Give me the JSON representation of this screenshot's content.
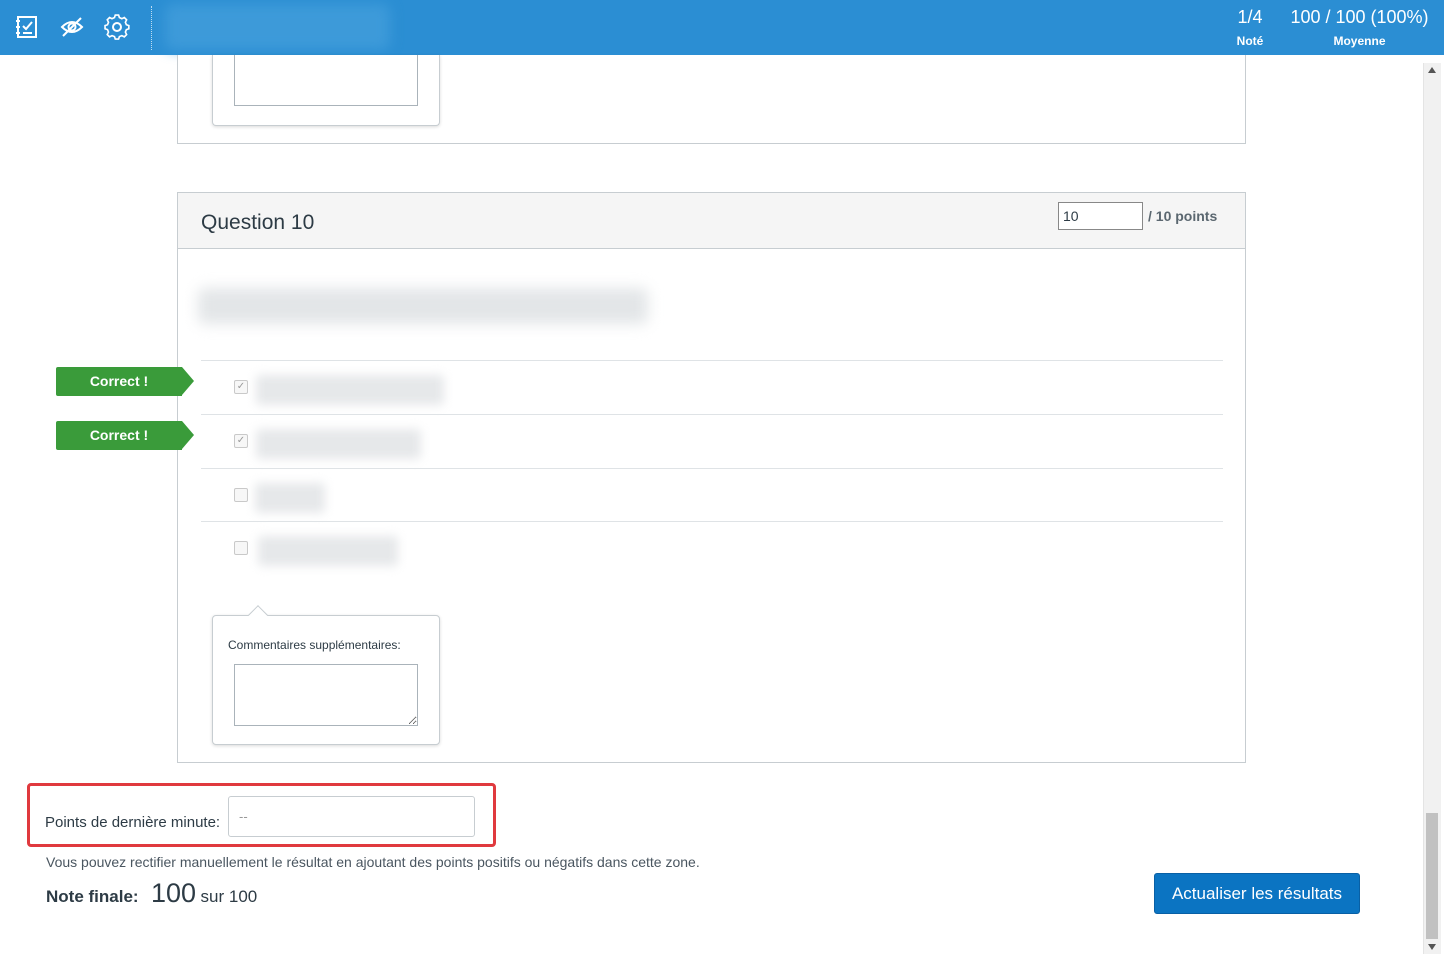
{
  "topbar": {
    "graded_count": "1/4",
    "graded_label": "Noté",
    "average_value": "100 / 100 (100%)",
    "average_label": "Moyenne",
    "icons": [
      "speedgrader-icon",
      "eye-slash-icon",
      "gear-icon"
    ]
  },
  "question": {
    "title": "Question 10",
    "points_value": "10",
    "points_label": "/ 10 points",
    "answers": [
      {
        "checked": true,
        "correct_label": "Correct !"
      },
      {
        "checked": true,
        "correct_label": "Correct !"
      },
      {
        "checked": false
      },
      {
        "checked": false
      }
    ],
    "comment_label": "Commentaires supplémentaires:"
  },
  "fudge": {
    "label": "Points de dernière minute:",
    "placeholder": "--",
    "help_text": "Vous pouvez rectifier manuellement le résultat en ajoutant des points positifs ou négatifs dans cette zone."
  },
  "final": {
    "label": "Note finale:",
    "score": "100",
    "total": "sur 100"
  },
  "update_button": "Actualiser les résultats",
  "colors": {
    "topbar": "#2b8ed3",
    "correct": "#3a9b3a",
    "highlight": "#e0393e",
    "button": "#0b74c2"
  }
}
